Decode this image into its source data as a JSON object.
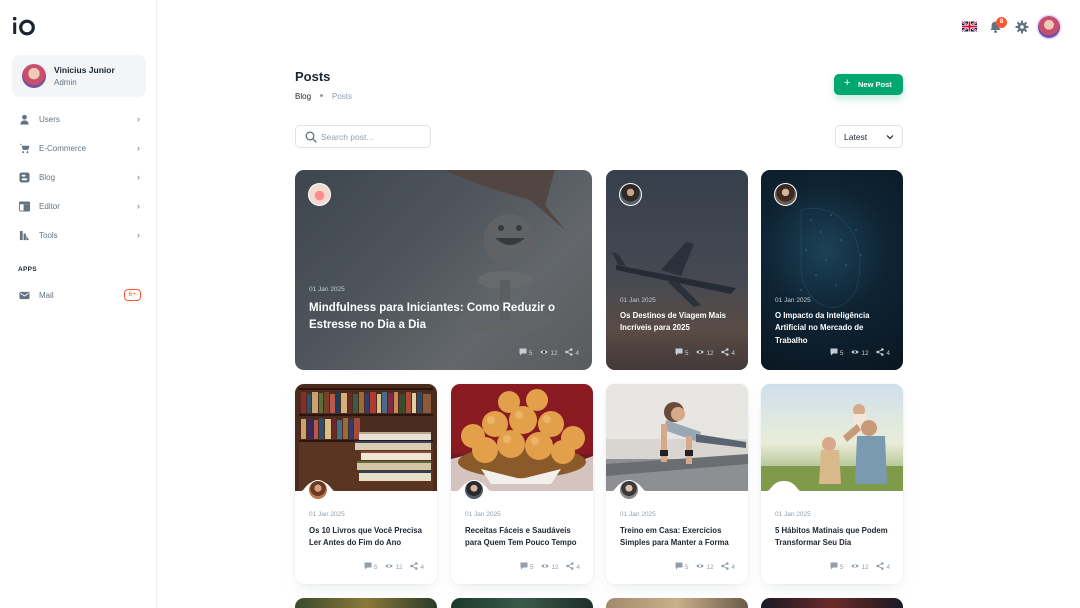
{
  "account": {
    "name": "Vinicius Junior",
    "role": "Admin"
  },
  "nav": [
    {
      "label": "Users",
      "icon": "user-icon"
    },
    {
      "label": "E-Commerce",
      "icon": "cart-icon"
    },
    {
      "label": "Blog",
      "icon": "blog-icon"
    },
    {
      "label": "Editor",
      "icon": "editor-icon"
    },
    {
      "label": "Tools",
      "icon": "tools-icon"
    }
  ],
  "apps": {
    "title": "APPS",
    "mail": {
      "label": "Mail",
      "badge": "6+"
    }
  },
  "topbar": {
    "notifications": "8",
    "language": "uk-flag-icon"
  },
  "header": {
    "title": "Posts",
    "breadcrumb": [
      "Blog",
      "Posts"
    ],
    "new_post": "New Post"
  },
  "search": {
    "placeholder": "Search post..."
  },
  "sort": {
    "value": "Latest"
  },
  "colors": {
    "primary": "#00a76f",
    "error": "#ff5630",
    "text": "#1c252e",
    "muted": "#919eab"
  },
  "featured": [
    {
      "date": "01 Jan 2025",
      "title": "Mindfulness para Iniciantes: Como Reduzir o Estresse no Dia a Dia",
      "comments": "5",
      "views": "12",
      "shares": "4"
    },
    {
      "date": "01 Jan 2025",
      "title": "Os Destinos de Viagem Mais Incríveis para 2025",
      "comments": "5",
      "views": "12",
      "shares": "4"
    },
    {
      "date": "01 Jan 2025",
      "title": "O Impacto da Inteligência Artificial no Mercado de Trabalho",
      "comments": "5",
      "views": "12",
      "shares": "4"
    }
  ],
  "posts": [
    {
      "date": "01 Jan 2025",
      "title": "Os 10 Livros que Você Precisa Ler Antes do Fim do Ano",
      "comments": "5",
      "views": "12",
      "shares": "4"
    },
    {
      "date": "01 Jan 2025",
      "title": "Receitas Fáceis e Saudáveis para Quem Tem Pouco Tempo",
      "comments": "5",
      "views": "12",
      "shares": "4"
    },
    {
      "date": "01 Jan 2025",
      "title": "Treino em Casa: Exercícios Simples para Manter a Forma",
      "comments": "5",
      "views": "12",
      "shares": "4"
    },
    {
      "date": "01 Jan 2025",
      "title": "5 Hábitos Matinais que Podem Transformar Seu Dia",
      "comments": "5",
      "views": "12",
      "shares": "4"
    }
  ]
}
